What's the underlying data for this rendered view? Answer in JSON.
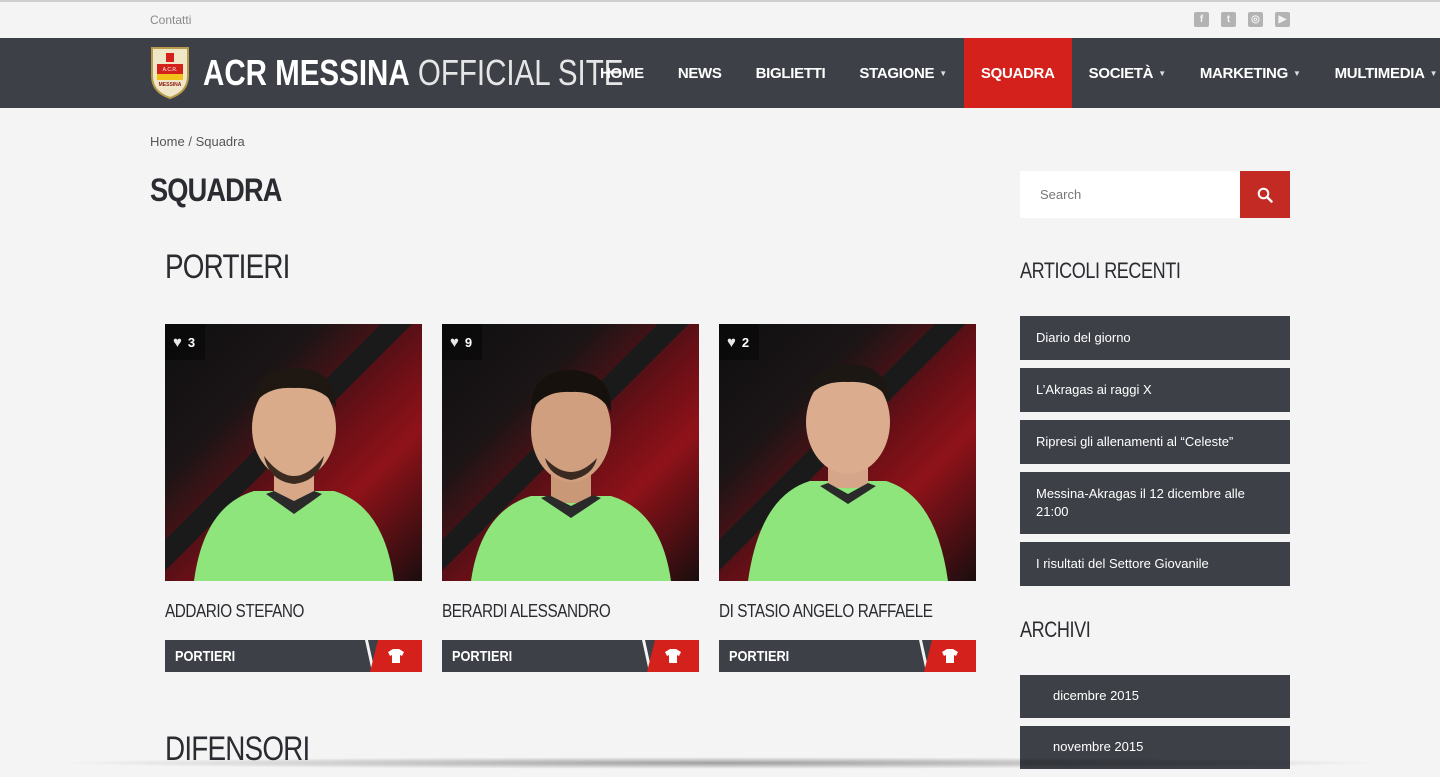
{
  "topbar": {
    "contact_label": "Contatti",
    "social": [
      "facebook-icon",
      "twitter-icon",
      "instagram-icon",
      "youtube-icon"
    ]
  },
  "header": {
    "brand_bold": "ACR MESSINA",
    "brand_light": " OFFICIAL SITE",
    "nav": [
      {
        "label": "HOME",
        "dropdown": false,
        "active": false
      },
      {
        "label": "NEWS",
        "dropdown": false,
        "active": false
      },
      {
        "label": "BIGLIETTI",
        "dropdown": false,
        "active": false
      },
      {
        "label": "STAGIONE",
        "dropdown": true,
        "active": false
      },
      {
        "label": "SQUADRA",
        "dropdown": false,
        "active": true
      },
      {
        "label": "SOCIETÀ",
        "dropdown": true,
        "active": false
      },
      {
        "label": "MARKETING",
        "dropdown": true,
        "active": false
      },
      {
        "label": "MULTIMEDIA",
        "dropdown": true,
        "active": false
      }
    ],
    "logo_text": {
      "top": "A.C.R.",
      "bottom": "MESSINA"
    }
  },
  "breadcrumb": {
    "home": "Home",
    "separator": "/",
    "current": "Squadra"
  },
  "page_title": "SQUADRA",
  "sections": [
    {
      "title": "PORTIERI",
      "players": [
        {
          "name": "ADDARIO STEFANO",
          "likes": "3",
          "role": "PORTIERI"
        },
        {
          "name": "BERARDI ALESSANDRO",
          "likes": "9",
          "role": "PORTIERI"
        },
        {
          "name": "DI STASIO ANGELO RAFFAELE",
          "likes": "2",
          "role": "PORTIERI"
        }
      ]
    },
    {
      "title": "DIFENSORI"
    }
  ],
  "sidebar": {
    "search_placeholder": "Search",
    "recent_title": "ARTICOLI RECENTI",
    "recent": [
      "Diario del giorno",
      "L’Akragas ai raggi X",
      "Ripresi gli allenamenti al “Celeste”",
      "Messina-Akragas il 12 dicembre alle 21:00",
      "I risultati del Settore Giovanile"
    ],
    "archive_title": "ARCHIVI",
    "archives": [
      "dicembre 2015",
      "novembre 2015"
    ]
  },
  "colors": {
    "header_bg": "#3d4047",
    "accent": "#d4211b",
    "page_bg": "#f4f4f4",
    "jersey": "#8ee57c"
  }
}
